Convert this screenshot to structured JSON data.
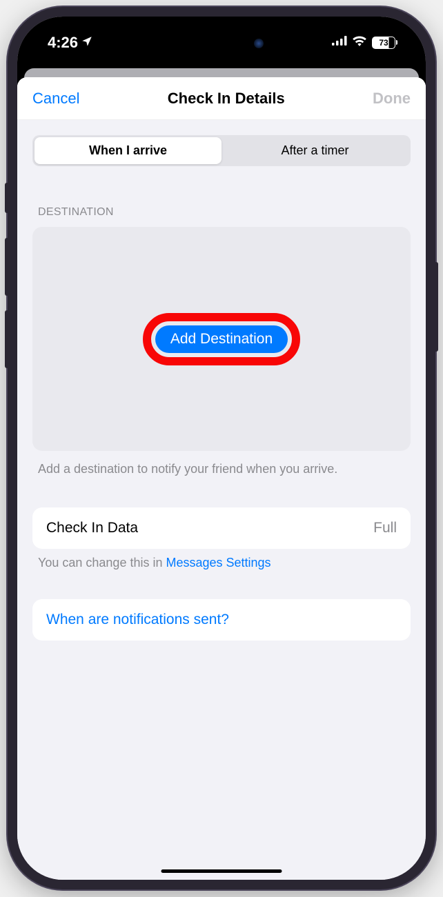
{
  "status": {
    "time": "4:26",
    "battery": "73"
  },
  "nav": {
    "cancel": "Cancel",
    "title": "Check In Details",
    "done": "Done"
  },
  "segments": {
    "arrive": "When I arrive",
    "timer": "After a timer"
  },
  "destination": {
    "header": "Destination",
    "button": "Add Destination",
    "helper": "Add a destination to notify your friend when you arrive."
  },
  "checkin": {
    "label": "Check In Data",
    "value": "Full",
    "helper_prefix": "You can change this in ",
    "helper_link": "Messages Settings"
  },
  "notifications": {
    "label": "When are notifications sent?"
  }
}
